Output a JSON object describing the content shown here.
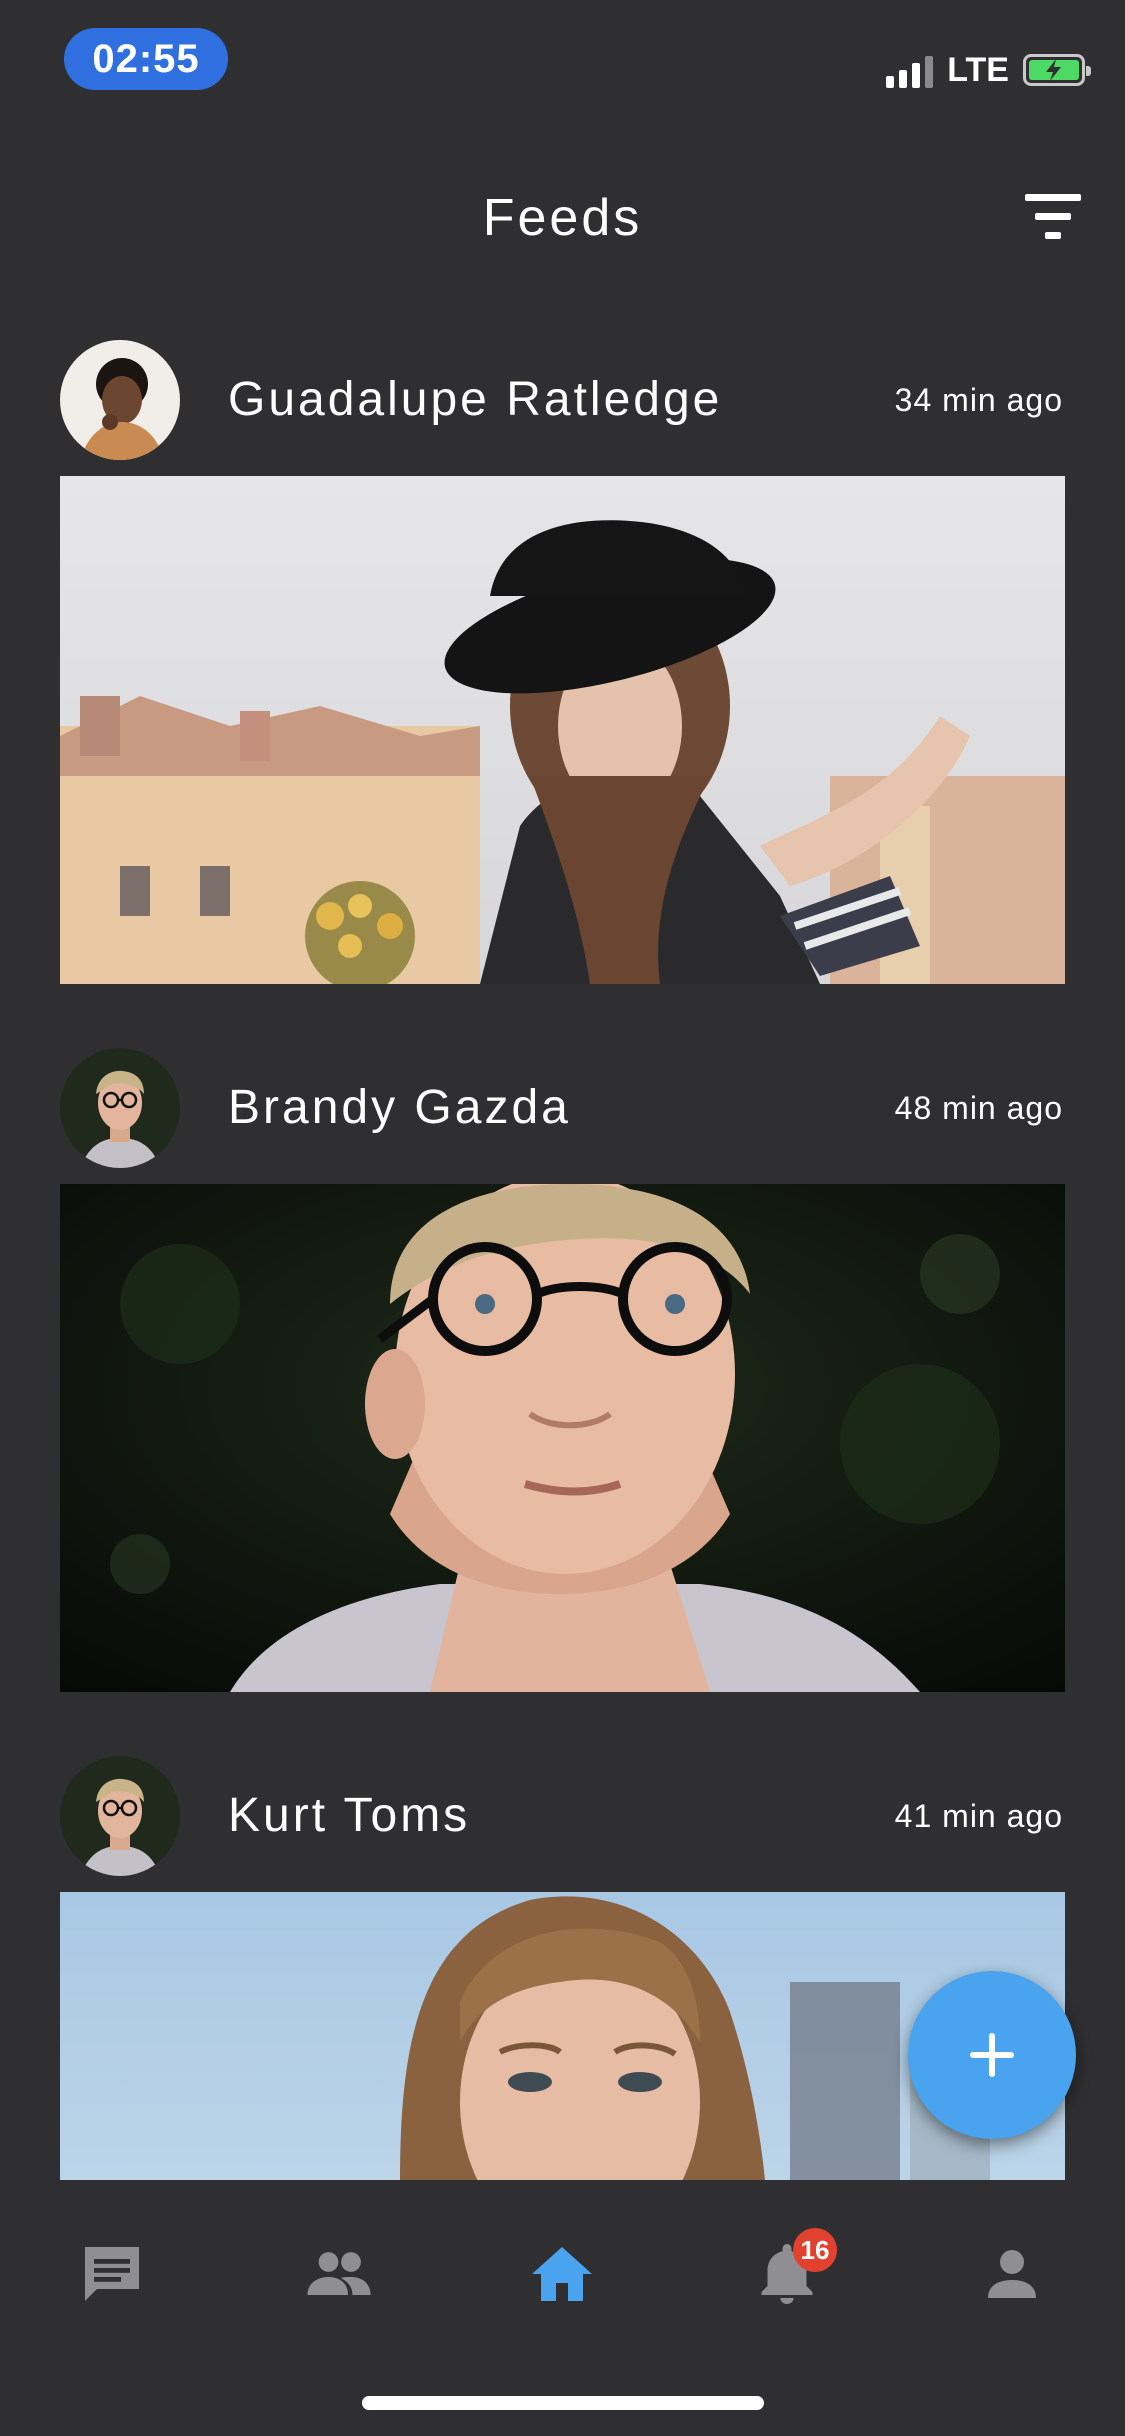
{
  "status_bar": {
    "time": "02:55",
    "network": "LTE",
    "icons": [
      "signal-bars-icon",
      "battery-charging-icon"
    ],
    "battery_color": "#4cd964"
  },
  "header": {
    "title": "Feeds",
    "filter_icon": "filter-icon"
  },
  "posts": [
    {
      "author": "Guadalupe Ratledge",
      "time": "34 min ago"
    },
    {
      "author": "Brandy Gazda",
      "time": "48 min ago"
    },
    {
      "author": "Kurt Toms",
      "time": "41 min ago"
    }
  ],
  "fab": {
    "icon": "plus-icon",
    "color": "#4aa3ee"
  },
  "bottom_nav": {
    "items": [
      {
        "icon": "chat-icon",
        "active": false
      },
      {
        "icon": "people-icon",
        "active": false
      },
      {
        "icon": "home-icon",
        "active": true
      },
      {
        "icon": "bell-icon",
        "active": false,
        "badge": "16"
      },
      {
        "icon": "person-icon",
        "active": false
      }
    ],
    "active_color": "#4aa3ee",
    "inactive_color": "#8e8e93",
    "badge_color": "#e2412f"
  },
  "theme": {
    "background": "#2f2f31"
  }
}
